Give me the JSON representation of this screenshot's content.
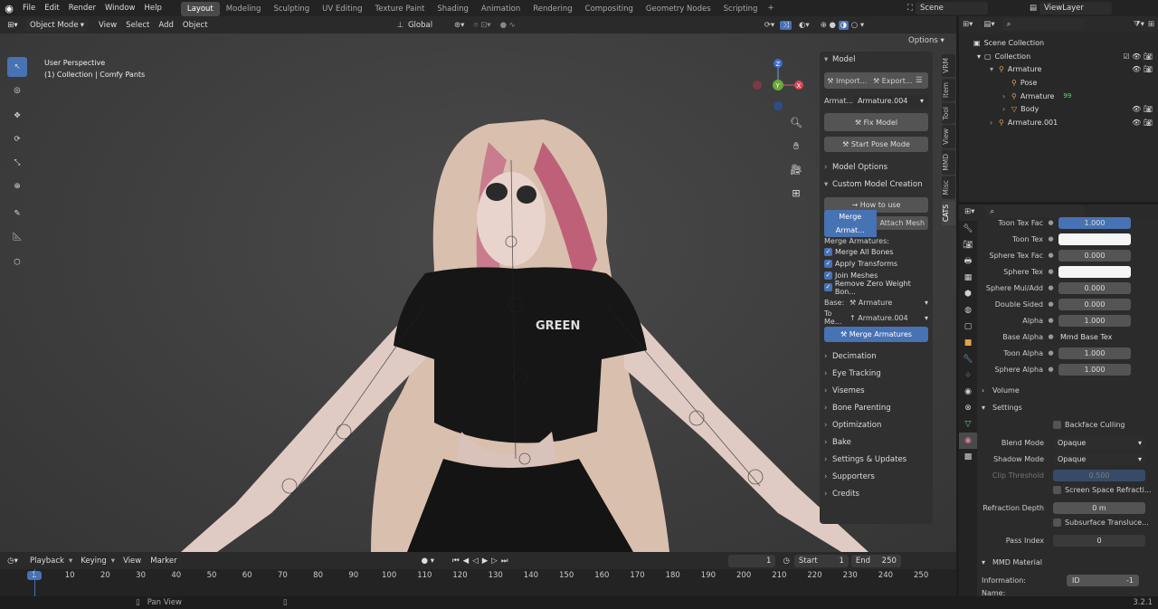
{
  "topbar": {
    "menus": [
      "File",
      "Edit",
      "Render",
      "Window",
      "Help"
    ],
    "workspaces": [
      "Layout",
      "Modeling",
      "Sculpting",
      "UV Editing",
      "Texture Paint",
      "Shading",
      "Animation",
      "Rendering",
      "Compositing",
      "Geometry Nodes",
      "Scripting"
    ],
    "active_workspace": "Layout",
    "scene": "Scene",
    "view_layer": "ViewLayer"
  },
  "viewport_header": {
    "mode": "Object Mode",
    "menus": [
      "View",
      "Select",
      "Add",
      "Object"
    ],
    "transform": "Global",
    "options": "Options"
  },
  "viewport": {
    "view_name": "User Perspective",
    "collection_line": "(1) Collection | Comfy Pants",
    "shirt_text": "GREEN"
  },
  "npanel": {
    "header": "Model",
    "import": "Import...",
    "export": "Export...",
    "armature_label": "Armat...",
    "armature_value": "Armature.004",
    "fix_model": "Fix Model",
    "start_pose": "Start Pose Mode",
    "model_options": "Model Options",
    "custom_creation": "Custom Model Creation",
    "how_to_use": "How to use",
    "merge_armatures_tab": "Merge Armat...",
    "attach_mesh_tab": "Attach Mesh",
    "merge_heading": "Merge Armatures:",
    "checks": [
      "Merge All Bones",
      "Apply Transforms",
      "Join Meshes",
      "Remove Zero Weight Bon..."
    ],
    "base_label": "Base:",
    "base_value": "Armature",
    "to_label": "To Me...",
    "to_value": "Armature.004",
    "merge_button": "Merge Armatures",
    "sections": [
      "Decimation",
      "Eye Tracking",
      "Visemes",
      "Bone Parenting",
      "Optimization",
      "Bake",
      "Settings & Updates",
      "Supporters",
      "Credits"
    ]
  },
  "side_tabs": [
    "VRM",
    "Item",
    "Tool",
    "View",
    "MMD",
    "Misc",
    "CATS"
  ],
  "outliner": {
    "root": "Scene Collection",
    "collection": "Collection",
    "items": [
      {
        "label": "Armature",
        "depth": 1
      },
      {
        "label": "Pose",
        "depth": 2
      },
      {
        "label": "Armature",
        "depth": 2
      },
      {
        "label": "Body",
        "depth": 2
      },
      {
        "label": "Armature.001",
        "depth": 1
      }
    ],
    "badge": "99"
  },
  "props": {
    "rows": [
      {
        "label": "Toon Tex Fac",
        "value": "1.000",
        "style": "blue"
      },
      {
        "label": "Toon Tex",
        "value": "",
        "style": "white"
      },
      {
        "label": "Sphere Tex Fac",
        "value": "0.000",
        "style": "num"
      },
      {
        "label": "Sphere Tex",
        "value": "",
        "style": "white"
      },
      {
        "label": "Sphere Mul/Add",
        "value": "0.000",
        "style": "num"
      },
      {
        "label": "Double Sided",
        "value": "0.000",
        "style": "num"
      },
      {
        "label": "Alpha",
        "value": "1.000",
        "style": "num"
      },
      {
        "label": "Base Alpha",
        "value": "Mmd Base Tex",
        "style": "node"
      },
      {
        "label": "Toon Alpha",
        "value": "1.000",
        "style": "num"
      },
      {
        "label": "Sphere Alpha",
        "value": "1.000",
        "style": "num"
      }
    ],
    "volume": "Volume",
    "settings": "Settings",
    "backface": "Backface Culling",
    "blend_label": "Blend Mode",
    "blend_value": "Opaque",
    "shadow_label": "Shadow Mode",
    "shadow_value": "Opaque",
    "clip_label": "Clip Threshold",
    "clip_value": "0.500",
    "ssr": "Screen Space Refracti...",
    "refr_label": "Refraction Depth",
    "refr_value": "0 m",
    "sss": "Subsurface Transluce...",
    "pass_label": "Pass Index",
    "pass_value": "0",
    "mmd_material": "MMD Material",
    "info_label": "Information:",
    "info_id": "ID",
    "info_val": "-1",
    "name_label": "Name:"
  },
  "timeline": {
    "menus": [
      "Playback",
      "Keying",
      "View",
      "Marker"
    ],
    "current": "1",
    "start_label": "Start",
    "start": "1",
    "end_label": "End",
    "end": "250",
    "ticks": [
      "1",
      "10",
      "20",
      "30",
      "40",
      "50",
      "60",
      "70",
      "80",
      "90",
      "100",
      "110",
      "120",
      "130",
      "140",
      "150",
      "160",
      "170",
      "180",
      "190",
      "200",
      "210",
      "220",
      "230",
      "240",
      "250"
    ]
  },
  "status": {
    "pan": "Pan View",
    "version": "3.2.1"
  },
  "colors": {
    "accent": "#4772b3",
    "bg": "#1d1d1d",
    "panel": "#303030"
  }
}
